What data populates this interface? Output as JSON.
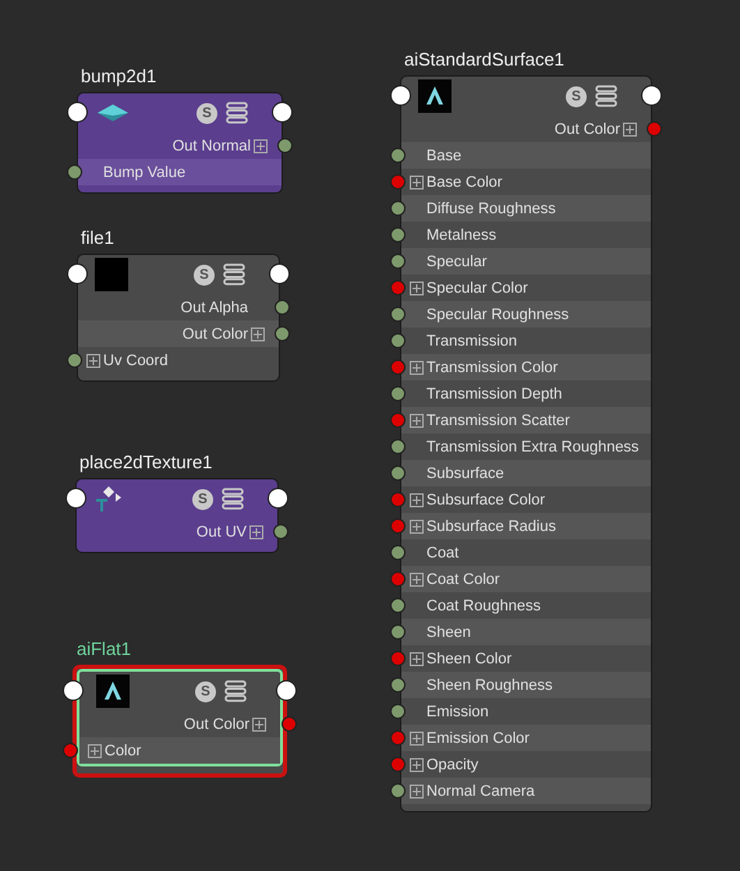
{
  "nodes": [
    {
      "title": "bump2d1",
      "kind": "utility",
      "selected": false,
      "badge": "S",
      "rows": [
        {
          "label": "Out Normal",
          "kind": "output",
          "expandable": true,
          "color": "#7e9a6c"
        },
        {
          "label": "Bump Value",
          "kind": "input",
          "expandable": false,
          "color": "#7e9a6c"
        }
      ]
    },
    {
      "title": "file1",
      "kind": "texture",
      "selected": false,
      "badge": "S",
      "rows": [
        {
          "label": "Out Alpha",
          "kind": "output",
          "expandable": false,
          "color": "#7e9a6c"
        },
        {
          "label": "Out Color",
          "kind": "output",
          "expandable": true,
          "color": "#7e9a6c"
        },
        {
          "label": "Uv Coord",
          "kind": "input",
          "expandable": true,
          "color": "#7e9a6c"
        }
      ]
    },
    {
      "title": "place2dTexture1",
      "kind": "utility",
      "selected": false,
      "badge": "S",
      "rows": [
        {
          "label": "Out UV",
          "kind": "output",
          "expandable": true,
          "color": "#7e9a6c"
        }
      ]
    },
    {
      "title": "aiFlat1",
      "kind": "shader",
      "selected": true,
      "badge": "S",
      "rows": [
        {
          "label": "Out Color",
          "kind": "output",
          "expandable": true,
          "color": "#dd0000"
        },
        {
          "label": "Color",
          "kind": "input",
          "expandable": true,
          "color": "#dd0000"
        }
      ]
    },
    {
      "title": "aiStandardSurface1",
      "kind": "shader",
      "selected": false,
      "badge": "S",
      "rows": [
        {
          "label": "Out Color",
          "kind": "output",
          "expandable": true,
          "color": "#dd0000"
        },
        {
          "label": "Base",
          "kind": "input",
          "expandable": false,
          "color": "#7e9a6c"
        },
        {
          "label": "Base Color",
          "kind": "input",
          "expandable": true,
          "color": "#dd0000"
        },
        {
          "label": "Diffuse Roughness",
          "kind": "input",
          "expandable": false,
          "color": "#7e9a6c"
        },
        {
          "label": "Metalness",
          "kind": "input",
          "expandable": false,
          "color": "#7e9a6c"
        },
        {
          "label": "Specular",
          "kind": "input",
          "expandable": false,
          "color": "#7e9a6c"
        },
        {
          "label": "Specular Color",
          "kind": "input",
          "expandable": true,
          "color": "#dd0000"
        },
        {
          "label": "Specular Roughness",
          "kind": "input",
          "expandable": false,
          "color": "#7e9a6c"
        },
        {
          "label": "Transmission",
          "kind": "input",
          "expandable": false,
          "color": "#7e9a6c"
        },
        {
          "label": "Transmission Color",
          "kind": "input",
          "expandable": true,
          "color": "#dd0000"
        },
        {
          "label": "Transmission Depth",
          "kind": "input",
          "expandable": false,
          "color": "#7e9a6c"
        },
        {
          "label": "Transmission Scatter",
          "kind": "input",
          "expandable": true,
          "color": "#dd0000"
        },
        {
          "label": "Transmission Extra Roughness",
          "kind": "input",
          "expandable": false,
          "color": "#7e9a6c"
        },
        {
          "label": "Subsurface",
          "kind": "input",
          "expandable": false,
          "color": "#7e9a6c"
        },
        {
          "label": "Subsurface Color",
          "kind": "input",
          "expandable": true,
          "color": "#dd0000"
        },
        {
          "label": "Subsurface Radius",
          "kind": "input",
          "expandable": true,
          "color": "#dd0000"
        },
        {
          "label": "Coat",
          "kind": "input",
          "expandable": false,
          "color": "#7e9a6c"
        },
        {
          "label": "Coat Color",
          "kind": "input",
          "expandable": true,
          "color": "#dd0000"
        },
        {
          "label": "Coat Roughness",
          "kind": "input",
          "expandable": false,
          "color": "#7e9a6c"
        },
        {
          "label": "Sheen",
          "kind": "input",
          "expandable": false,
          "color": "#7e9a6c"
        },
        {
          "label": "Sheen Color",
          "kind": "input",
          "expandable": true,
          "color": "#dd0000"
        },
        {
          "label": "Sheen Roughness",
          "kind": "input",
          "expandable": false,
          "color": "#7e9a6c"
        },
        {
          "label": "Emission",
          "kind": "input",
          "expandable": false,
          "color": "#7e9a6c"
        },
        {
          "label": "Emission Color",
          "kind": "input",
          "expandable": true,
          "color": "#dd0000"
        },
        {
          "label": "Opacity",
          "kind": "input",
          "expandable": true,
          "color": "#dd0000"
        },
        {
          "label": "Normal Camera",
          "kind": "input",
          "expandable": true,
          "color": "#7e9a6c"
        }
      ]
    }
  ]
}
